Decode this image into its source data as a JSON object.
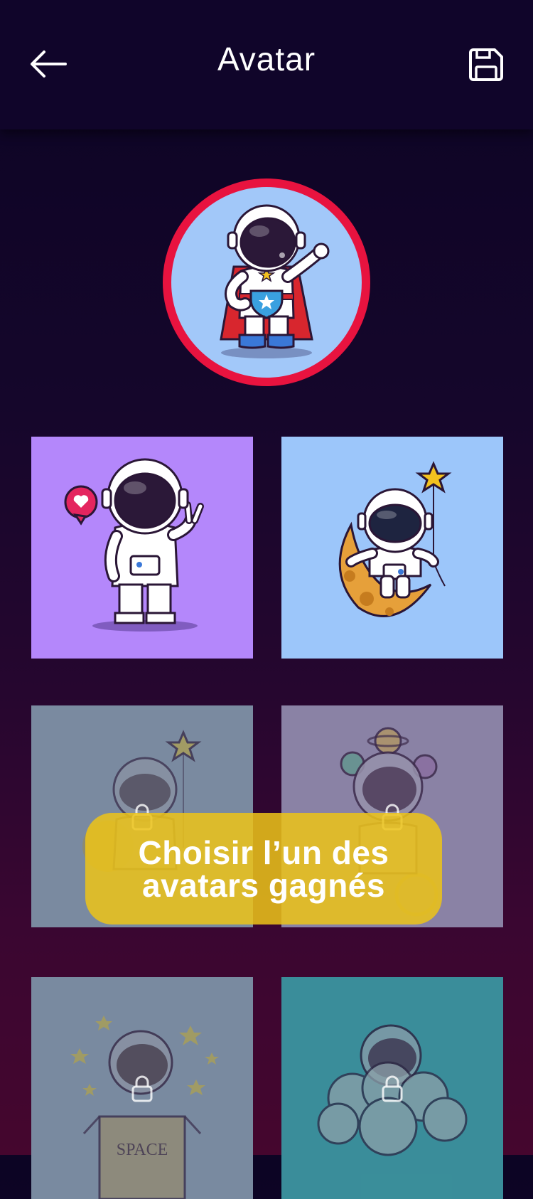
{
  "header": {
    "title": "Avatar",
    "back_icon": "arrow-left-icon",
    "save_icon": "floppy-disk-icon"
  },
  "selected_avatar": {
    "ring_color": "#e8133f",
    "background": "#a2c8f9",
    "name": "superhero-astronaut"
  },
  "avatars": [
    {
      "id": "astronaut-peace-heart",
      "background": "#b487fb",
      "locked": false
    },
    {
      "id": "astronaut-moon-star",
      "background": "#9cc6fa",
      "locked": false
    },
    {
      "id": "astronaut-star-balloon",
      "background": "#7a8aa0",
      "locked": true
    },
    {
      "id": "astronaut-planets-bike",
      "background": "#8a82a6",
      "locked": true
    },
    {
      "id": "astronaut-space-box",
      "background": "#7a8aa0",
      "locked": true
    },
    {
      "id": "astronaut-cloud",
      "background": "#3a8e9a",
      "locked": true
    }
  ],
  "toast": {
    "line1": "Choisir l’un des",
    "line2": "avatars gagnés",
    "color": "#ecc418"
  },
  "box_label": "SPACE"
}
